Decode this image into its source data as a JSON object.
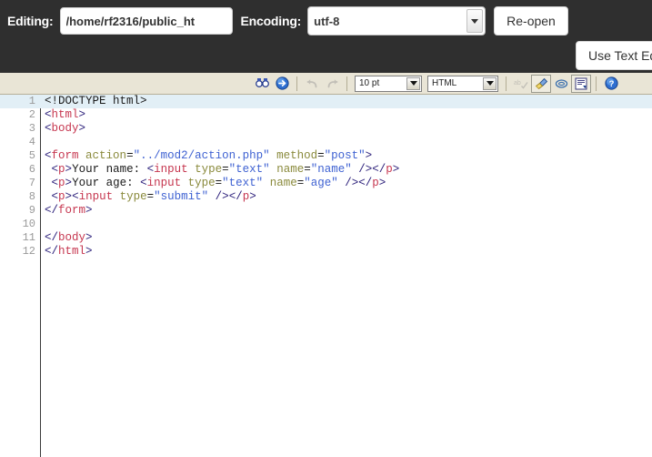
{
  "header": {
    "editing_label": "Editing:",
    "path_value": "/home/rf2316/public_ht",
    "encoding_label": "Encoding:",
    "encoding_value": "utf-8",
    "reopen_label": "Re-open",
    "use_text_editor_label": "Use Text Ed",
    "background_color": "#2f2f2f"
  },
  "toolbar": {
    "background_color": "#e9e5d6",
    "font_size_value": "10 pt",
    "syntax_mode_value": "HTML",
    "icons": [
      {
        "name": "find-icon",
        "title": "Find"
      },
      {
        "name": "goto-line-icon",
        "title": "Go to line"
      },
      {
        "name": "undo-icon",
        "title": "Undo"
      },
      {
        "name": "redo-icon",
        "title": "Redo"
      },
      {
        "name": "spellcheck-icon",
        "title": "Spell check"
      },
      {
        "name": "clean-icon",
        "title": "Clean"
      },
      {
        "name": "eraser-icon",
        "title": "Erase"
      },
      {
        "name": "word-wrap-icon",
        "title": "Word wrap"
      },
      {
        "name": "help-icon",
        "title": "Help"
      }
    ]
  },
  "editor": {
    "active_line": 1,
    "active_line_color": "#e2eff6",
    "total_lines": 12,
    "lines": [
      {
        "n": "1",
        "tokens": [
          {
            "c": "dct",
            "t": "<!DOCTYPE html>"
          }
        ]
      },
      {
        "n": "2",
        "tokens": [
          {
            "c": "br",
            "t": "<"
          },
          {
            "c": "tag",
            "t": "html"
          },
          {
            "c": "br",
            "t": ">"
          }
        ]
      },
      {
        "n": "3",
        "tokens": [
          {
            "c": "br",
            "t": "<"
          },
          {
            "c": "tag",
            "t": "body"
          },
          {
            "c": "br",
            "t": ">"
          }
        ]
      },
      {
        "n": "4",
        "tokens": []
      },
      {
        "n": "5",
        "tokens": [
          {
            "c": "br",
            "t": "<"
          },
          {
            "c": "tag",
            "t": "form"
          },
          {
            "c": "txt",
            "t": " "
          },
          {
            "c": "atr",
            "t": "action"
          },
          {
            "c": "txt",
            "t": "="
          },
          {
            "c": "str",
            "t": "\"../mod2/action.php\""
          },
          {
            "c": "txt",
            "t": " "
          },
          {
            "c": "atr",
            "t": "method"
          },
          {
            "c": "txt",
            "t": "="
          },
          {
            "c": "str",
            "t": "\"post\""
          },
          {
            "c": "br",
            "t": ">"
          }
        ]
      },
      {
        "n": "6",
        "tokens": [
          {
            "c": "txt",
            "t": " "
          },
          {
            "c": "br",
            "t": "<"
          },
          {
            "c": "tag",
            "t": "p"
          },
          {
            "c": "br",
            "t": ">"
          },
          {
            "c": "txt",
            "t": "Your name: "
          },
          {
            "c": "br",
            "t": "<"
          },
          {
            "c": "tag",
            "t": "input"
          },
          {
            "c": "txt",
            "t": " "
          },
          {
            "c": "atr",
            "t": "type"
          },
          {
            "c": "txt",
            "t": "="
          },
          {
            "c": "str",
            "t": "\"text\""
          },
          {
            "c": "txt",
            "t": " "
          },
          {
            "c": "atr",
            "t": "name"
          },
          {
            "c": "txt",
            "t": "="
          },
          {
            "c": "str",
            "t": "\"name\""
          },
          {
            "c": "txt",
            "t": " "
          },
          {
            "c": "br",
            "t": "/>"
          },
          {
            "c": "br",
            "t": "</"
          },
          {
            "c": "tag",
            "t": "p"
          },
          {
            "c": "br",
            "t": ">"
          }
        ]
      },
      {
        "n": "7",
        "tokens": [
          {
            "c": "txt",
            "t": " "
          },
          {
            "c": "br",
            "t": "<"
          },
          {
            "c": "tag",
            "t": "p"
          },
          {
            "c": "br",
            "t": ">"
          },
          {
            "c": "txt",
            "t": "Your age: "
          },
          {
            "c": "br",
            "t": "<"
          },
          {
            "c": "tag",
            "t": "input"
          },
          {
            "c": "txt",
            "t": " "
          },
          {
            "c": "atr",
            "t": "type"
          },
          {
            "c": "txt",
            "t": "="
          },
          {
            "c": "str",
            "t": "\"text\""
          },
          {
            "c": "txt",
            "t": " "
          },
          {
            "c": "atr",
            "t": "name"
          },
          {
            "c": "txt",
            "t": "="
          },
          {
            "c": "str",
            "t": "\"age\""
          },
          {
            "c": "txt",
            "t": " "
          },
          {
            "c": "br",
            "t": "/>"
          },
          {
            "c": "br",
            "t": "</"
          },
          {
            "c": "tag",
            "t": "p"
          },
          {
            "c": "br",
            "t": ">"
          }
        ]
      },
      {
        "n": "8",
        "tokens": [
          {
            "c": "txt",
            "t": " "
          },
          {
            "c": "br",
            "t": "<"
          },
          {
            "c": "tag",
            "t": "p"
          },
          {
            "c": "br",
            "t": ">"
          },
          {
            "c": "br",
            "t": "<"
          },
          {
            "c": "tag",
            "t": "input"
          },
          {
            "c": "txt",
            "t": " "
          },
          {
            "c": "atr",
            "t": "type"
          },
          {
            "c": "txt",
            "t": "="
          },
          {
            "c": "str",
            "t": "\"submit\""
          },
          {
            "c": "txt",
            "t": " "
          },
          {
            "c": "br",
            "t": "/>"
          },
          {
            "c": "br",
            "t": "</"
          },
          {
            "c": "tag",
            "t": "p"
          },
          {
            "c": "br",
            "t": ">"
          }
        ]
      },
      {
        "n": "9",
        "tokens": [
          {
            "c": "br",
            "t": "</"
          },
          {
            "c": "tag",
            "t": "form"
          },
          {
            "c": "br",
            "t": ">"
          }
        ]
      },
      {
        "n": "10",
        "tokens": []
      },
      {
        "n": "11",
        "tokens": [
          {
            "c": "br",
            "t": "</"
          },
          {
            "c": "tag",
            "t": "body"
          },
          {
            "c": "br",
            "t": ">"
          }
        ]
      },
      {
        "n": "12",
        "tokens": [
          {
            "c": "br",
            "t": "</"
          },
          {
            "c": "tag",
            "t": "html"
          },
          {
            "c": "br",
            "t": ">"
          }
        ]
      }
    ]
  }
}
